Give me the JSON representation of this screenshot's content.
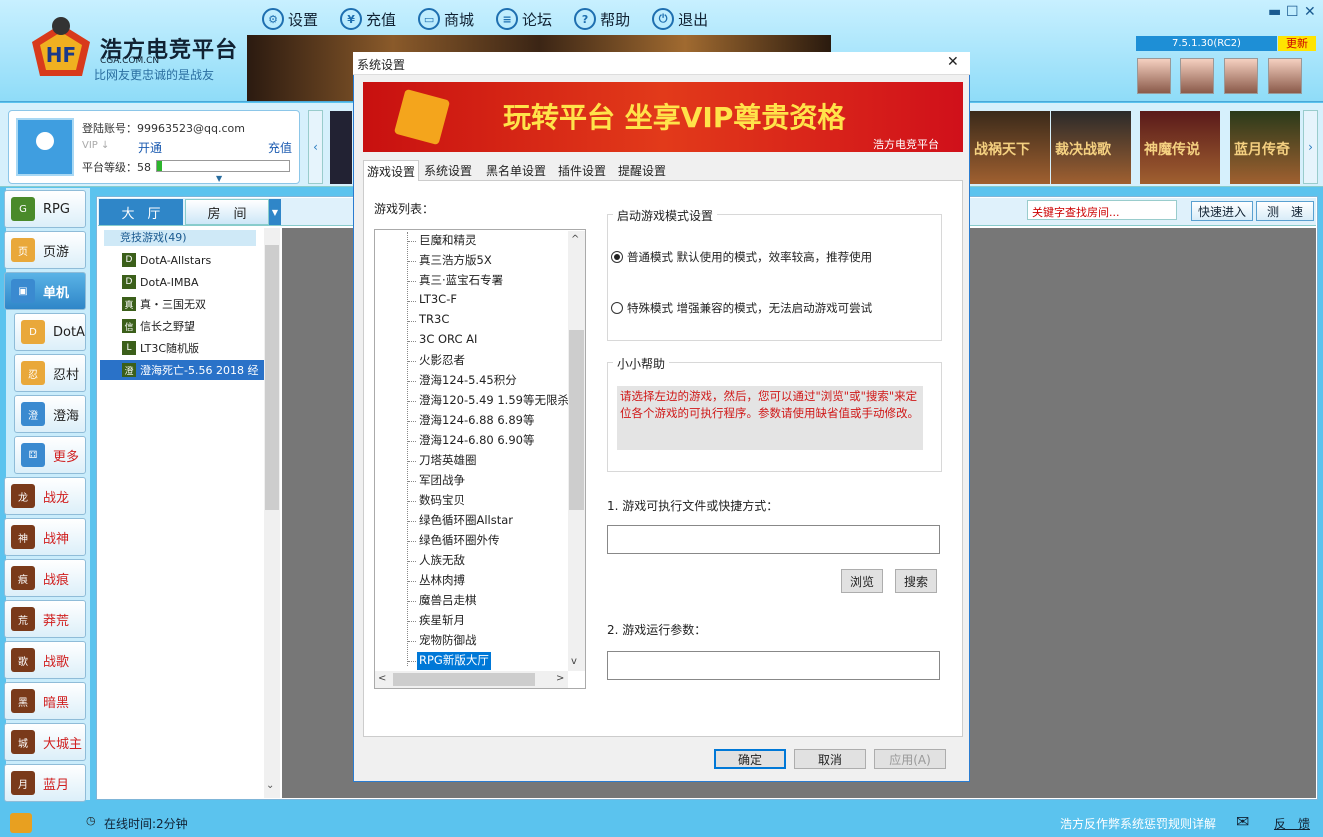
{
  "app": {
    "brand": "浩方电竞平台",
    "domain": "CGA.COM.CN",
    "slogan": "比网友更忠诚的是战友",
    "version": "7.5.1.30(RC2)",
    "update_label": "更新"
  },
  "menu": [
    {
      "icon": "gear-icon",
      "glyph": "⚙",
      "label": "设置"
    },
    {
      "icon": "yen-icon",
      "glyph": "¥",
      "label": "充值"
    },
    {
      "icon": "shop-icon",
      "glyph": "▭",
      "label": "商城"
    },
    {
      "icon": "forum-icon",
      "glyph": "≡",
      "label": "论坛"
    },
    {
      "icon": "help-icon",
      "glyph": "?",
      "label": "帮助"
    },
    {
      "icon": "power-icon",
      "glyph": "⏻",
      "label": "退出"
    }
  ],
  "user": {
    "account_label": "登陆账号：99963523@qq.com",
    "vip_label": "开通",
    "recharge_label": "充值",
    "level_label": "平台等级：58",
    "level_progress": 0.04
  },
  "banners": [
    {
      "title": "战祸天下"
    },
    {
      "title": "裁决战歌"
    },
    {
      "title": "神魔传说"
    },
    {
      "title": "蓝月传奇"
    }
  ],
  "sidebar": [
    {
      "label": "RPG",
      "icon": "rpg-icon",
      "glyph": "G",
      "style": ""
    },
    {
      "label": "页游",
      "icon": "webgame-icon",
      "glyph": "页",
      "style": ""
    },
    {
      "label": "单机",
      "icon": "single-icon",
      "glyph": "▣",
      "style": "active"
    },
    {
      "label": "DotA",
      "icon": "dota-icon",
      "glyph": "D",
      "style": "sub"
    },
    {
      "label": "忍村",
      "icon": "ninja-icon",
      "glyph": "忍",
      "style": "sub"
    },
    {
      "label": "澄海",
      "icon": "chenghai-icon",
      "glyph": "澄",
      "style": "sub"
    },
    {
      "label": "更多",
      "icon": "gamepad-icon",
      "glyph": "⚃",
      "style": "sub red"
    },
    {
      "label": "战龙",
      "icon": "game-icon",
      "glyph": "龙",
      "style": "red"
    },
    {
      "label": "战神",
      "icon": "game-icon",
      "glyph": "神",
      "style": "red"
    },
    {
      "label": "战痕",
      "icon": "game-icon",
      "glyph": "痕",
      "style": "red"
    },
    {
      "label": "莽荒",
      "icon": "game-icon",
      "glyph": "荒",
      "style": "red"
    },
    {
      "label": "战歌",
      "icon": "game-icon",
      "glyph": "歌",
      "style": "red"
    },
    {
      "label": "暗黑",
      "icon": "game-icon",
      "glyph": "黑",
      "style": "red"
    },
    {
      "label": "大城主",
      "icon": "game-icon",
      "glyph": "城",
      "style": "red"
    },
    {
      "label": "蓝月",
      "icon": "game-icon",
      "glyph": "月",
      "style": "red"
    }
  ],
  "lobby": {
    "tab_hall": "大　厅",
    "tab_room": "房　间",
    "category": "竞技游戏(49)",
    "games": [
      {
        "glyph": "D",
        "label": "DotA-Allstars"
      },
      {
        "glyph": "D",
        "label": "DotA-IMBA"
      },
      {
        "glyph": "真",
        "label": "真・三国无双"
      },
      {
        "glyph": "信",
        "label": "信长之野望"
      },
      {
        "glyph": "L",
        "label": "LT3C随机版"
      },
      {
        "glyph": "澄",
        "label": "澄海死亡-5.56 2018 经"
      }
    ],
    "search_placeholder": "关键字查找房间...",
    "quick_join": "快速进入",
    "speed_test": "测　速"
  },
  "status": {
    "online_time": "在线时间:2分钟",
    "anticheat": "浩方反作弊系统惩罚规则详解",
    "feedback": "反　馈"
  },
  "dialog": {
    "title": "系统设置",
    "banner_text": "玩转平台 坐享VIP尊贵资格",
    "banner_sub": "浩方电竞平台",
    "tabs": [
      "游戏设置",
      "系统设置",
      "黑名单设置",
      "插件设置",
      "提醒设置"
    ],
    "game_list_label": "游戏列表：",
    "game_list": [
      "巨魔和精灵",
      "真三浩方版5X",
      "真三·蓝宝石专署",
      "LT3C-F",
      "TR3C",
      "3C ORC AI",
      "火影忍者",
      "澄海124-5.45积分",
      "澄海120-5.49 1.59等无限杀",
      "澄海124-6.88 6.89等",
      "澄海124-6.80 6.90等",
      "刀塔英雄圈",
      "军团战争",
      "数码宝贝",
      "绿色循环圈Allstar",
      "绿色循环圈外传",
      "人族无敌",
      "丛林肉搏",
      "魔兽吕走棋",
      "疾星斩月",
      "宠物防御战",
      "RPG新版大厅"
    ],
    "mode_group": "启动游戏模式设置",
    "mode_normal": "普通模式 默认使用的模式，效率较高，推荐使用",
    "mode_special": "特殊模式 增强兼容的模式，无法启动游戏可尝试",
    "help_group": "小小帮助",
    "help_text": "请选择左边的游戏，然后，您可以通过\"浏览\"或\"搜索\"来定位各个游戏的可执行程序。参数请使用缺省值或手动修改。",
    "exe_label": "1. 游戏可执行文件或快捷方式：",
    "exe_value": "",
    "browse": "浏览",
    "search": "搜索",
    "params_label": "2. 游戏运行参数：",
    "params_value": "",
    "ok": "确定",
    "cancel": "取消",
    "apply": "应用(A)"
  }
}
